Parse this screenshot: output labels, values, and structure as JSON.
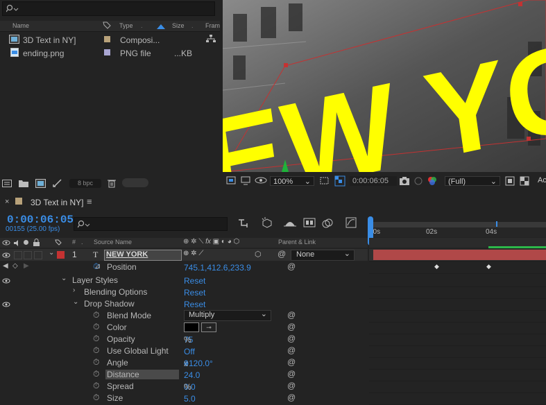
{
  "project": {
    "columns": {
      "name": "Name",
      "type": "Type",
      "size": "Size",
      "frame": "Fram"
    },
    "items": [
      {
        "name": "3D Text in NY]",
        "type": "Composi...",
        "size": "",
        "color": "#b8a27a"
      },
      {
        "name": "ending.png",
        "type": "PNG file",
        "size": "...KB",
        "color": "#a9a6d2"
      }
    ],
    "bpc": "8 bpc"
  },
  "viewer": {
    "text": "EW YORK",
    "text_color": "#ffff00",
    "zoom": "100%",
    "timecode": "0:00:06:05",
    "resolution": "(Full)",
    "extra": "Ac"
  },
  "timeline": {
    "tab_title": "3D Text in NY]",
    "timecode": "0:00:06:05",
    "fps": "00155 (25.00 fps)",
    "header": {
      "num": "#",
      "source": "Source Name",
      "parent": "Parent & Link"
    },
    "ruler": [
      "00s",
      "02s",
      "04s"
    ],
    "layer": {
      "num": "1",
      "type_glyph": "T",
      "name": "NEW YORK",
      "parent": "None"
    },
    "props": [
      {
        "label": "Position",
        "value": "745.1,412.6,233.9"
      },
      {
        "label": "Layer Styles",
        "value": "Reset"
      },
      {
        "label": "Blending Options",
        "value": "Reset"
      },
      {
        "label": "Drop Shadow",
        "value": "Reset"
      },
      {
        "label": "Blend Mode",
        "value": "Multiply"
      },
      {
        "label": "Color",
        "value": ""
      },
      {
        "label": "Opacity",
        "value": "75",
        "unit": "%"
      },
      {
        "label": "Use Global Light",
        "value": "Off"
      },
      {
        "label": "Angle",
        "value": "0",
        "unit": "x",
        "value2": "+120.0°"
      },
      {
        "label": "Distance",
        "value": "24.0"
      },
      {
        "label": "Spread",
        "value": "0.0",
        "unit": "%"
      },
      {
        "label": "Size",
        "value": "5.0"
      }
    ]
  }
}
